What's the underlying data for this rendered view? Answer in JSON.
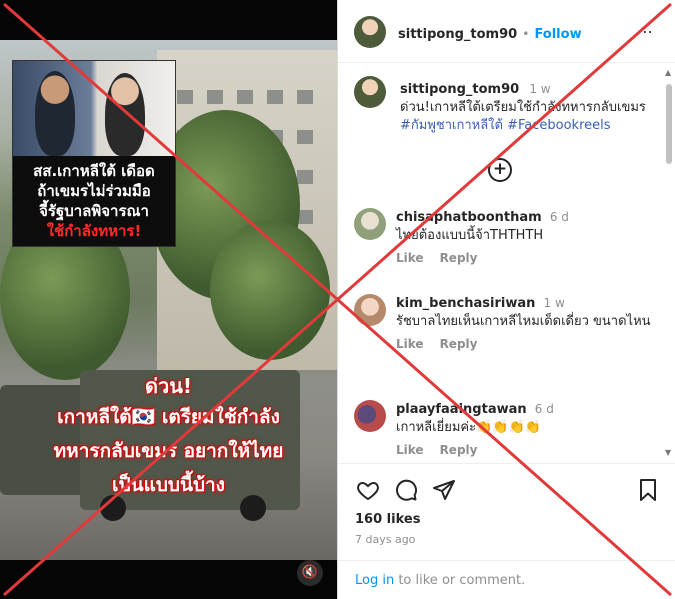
{
  "video": {
    "inset_lines": [
      "สส.เกาหลีใต้ เดือด",
      "ถ้าเขมรไม่ร่วมมือ",
      "จี้รัฐบาลพิจารณา",
      "ใช้กำลังทหาร!"
    ],
    "headline_lines": [
      "ด่วน!",
      "เกาหลีใต้🇰🇷 เตรียมใช้กำลัง",
      "ทหารกลับเขมร อยากให้ไทย",
      "เป็นแบบนี้บ้าง"
    ],
    "mute_icon": "speaker-muted-icon"
  },
  "post": {
    "username": "sittipong_tom90",
    "follow_label": "Follow",
    "separator": "•",
    "more_label": "⋯",
    "caption_time": "1 w",
    "caption_text": "ด่วน!เกาหลีใต้เตรียมใช้กำลังทหารกลับเขมร",
    "hashtags": "#กัมพูชาเกาหลีใต้ #Facebookreels",
    "load_more_icon": "plus-circle-icon",
    "comments": [
      {
        "user": "chisaphatboontham",
        "time": "6 d",
        "text": "ไทยต้องแบบนี้จ้าTHTHTH",
        "like": "Like",
        "reply": "Reply"
      },
      {
        "user": "kim_benchasiriwan",
        "time": "1 w",
        "text": "รัชบาลไทยเห็นเกาหลีไหมเด็ดเดี่ยว ขนาดไหน",
        "like": "Like",
        "reply": "Reply"
      },
      {
        "user": "plaayfaaingtawan",
        "time": "6 d",
        "text": "เกาหลีเยี่ยมค่ะ👏👏👏👏",
        "like": "Like",
        "reply": "Reply"
      }
    ],
    "likes": "160 likes",
    "ago": "7 days ago",
    "login_link": "Log in",
    "login_rest": " to like or comment."
  },
  "colors": {
    "accent": "#0095f6",
    "hashtag": "#3a5db8",
    "cross": "#e03a3a"
  }
}
